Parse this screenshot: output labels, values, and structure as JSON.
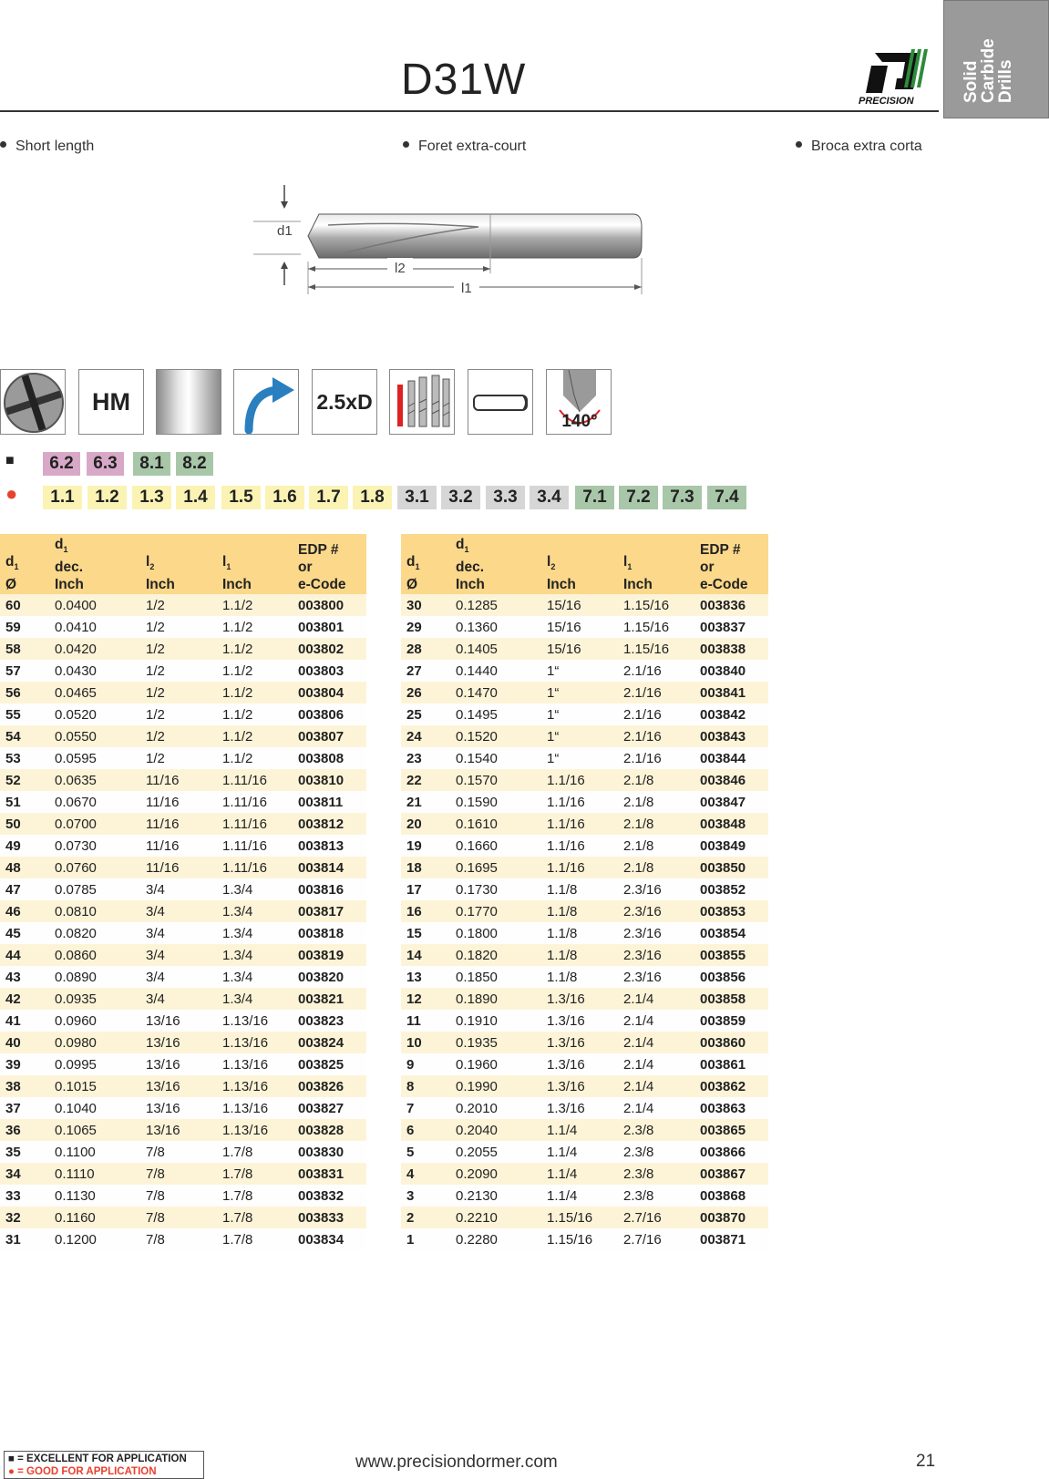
{
  "header": {
    "title": "D31W",
    "logo_text": "PRECISION",
    "side_tab": [
      "Solid",
      "Carbide",
      "Drills"
    ]
  },
  "descriptions": [
    "Short length",
    "Foret extra-court",
    "Broca extra corta"
  ],
  "drawing_labels": {
    "d1": "d1",
    "l2": "l2",
    "l1": "l1"
  },
  "icons": [
    {
      "name": "flute-cross-section-icon"
    },
    {
      "name": "hm-material-icon",
      "label": "HM"
    },
    {
      "name": "bright-finish-icon"
    },
    {
      "name": "right-hand-spiral-icon"
    },
    {
      "name": "depth-ratio-icon",
      "label": "2.5xD"
    },
    {
      "name": "drill-series-icon"
    },
    {
      "name": "cylindrical-shank-icon"
    },
    {
      "name": "point-angle-icon",
      "label": "140°"
    }
  ],
  "applications": {
    "excellent": [
      "6.2",
      "6.3",
      "8.1",
      "8.2"
    ],
    "good": [
      "1.1",
      "1.2",
      "1.3",
      "1.4",
      "1.5",
      "1.6",
      "1.7",
      "1.8",
      "3.1",
      "3.2",
      "3.3",
      "3.4",
      "7.1",
      "7.2",
      "7.3",
      "7.4"
    ]
  },
  "colors": {
    "pink": "#d8a9c6",
    "green": "#a8c7a8",
    "yellow": "#fbf3b4",
    "grey": "#d6d6d6",
    "header": "#fbd88a",
    "stripe": "#fdf4d8"
  },
  "table_headers": {
    "d1": "d",
    "d1_sub": "1",
    "d1_sym": "Ø",
    "dec": "dec.",
    "dec_sub": "1",
    "dec_unit": "Inch",
    "l2": "l",
    "l2_sub": "2",
    "l2_unit": "Inch",
    "l1": "l",
    "l1_sub": "1",
    "l1_unit": "Inch",
    "edp1": "EDP #",
    "edp2": "or",
    "edp3": "e-Code"
  },
  "table_left": [
    [
      "60",
      "0.0400",
      "1/2",
      "1.1/2",
      "003800"
    ],
    [
      "59",
      "0.0410",
      "1/2",
      "1.1/2",
      "003801"
    ],
    [
      "58",
      "0.0420",
      "1/2",
      "1.1/2",
      "003802"
    ],
    [
      "57",
      "0.0430",
      "1/2",
      "1.1/2",
      "003803"
    ],
    [
      "56",
      "0.0465",
      "1/2",
      "1.1/2",
      "003804"
    ],
    [
      "55",
      "0.0520",
      "1/2",
      "1.1/2",
      "003806"
    ],
    [
      "54",
      "0.0550",
      "1/2",
      "1.1/2",
      "003807"
    ],
    [
      "53",
      "0.0595",
      "1/2",
      "1.1/2",
      "003808"
    ],
    [
      "52",
      "0.0635",
      "11/16",
      "1.11/16",
      "003810"
    ],
    [
      "51",
      "0.0670",
      "11/16",
      "1.11/16",
      "003811"
    ],
    [
      "50",
      "0.0700",
      "11/16",
      "1.11/16",
      "003812"
    ],
    [
      "49",
      "0.0730",
      "11/16",
      "1.11/16",
      "003813"
    ],
    [
      "48",
      "0.0760",
      "11/16",
      "1.11/16",
      "003814"
    ],
    [
      "47",
      "0.0785",
      "3/4",
      "1.3/4",
      "003816"
    ],
    [
      "46",
      "0.0810",
      "3/4",
      "1.3/4",
      "003817"
    ],
    [
      "45",
      "0.0820",
      "3/4",
      "1.3/4",
      "003818"
    ],
    [
      "44",
      "0.0860",
      "3/4",
      "1.3/4",
      "003819"
    ],
    [
      "43",
      "0.0890",
      "3/4",
      "1.3/4",
      "003820"
    ],
    [
      "42",
      "0.0935",
      "3/4",
      "1.3/4",
      "003821"
    ],
    [
      "41",
      "0.0960",
      "13/16",
      "1.13/16",
      "003823"
    ],
    [
      "40",
      "0.0980",
      "13/16",
      "1.13/16",
      "003824"
    ],
    [
      "39",
      "0.0995",
      "13/16",
      "1.13/16",
      "003825"
    ],
    [
      "38",
      "0.1015",
      "13/16",
      "1.13/16",
      "003826"
    ],
    [
      "37",
      "0.1040",
      "13/16",
      "1.13/16",
      "003827"
    ],
    [
      "36",
      "0.1065",
      "13/16",
      "1.13/16",
      "003828"
    ],
    [
      "35",
      "0.1100",
      "7/8",
      "1.7/8",
      "003830"
    ],
    [
      "34",
      "0.1110",
      "7/8",
      "1.7/8",
      "003831"
    ],
    [
      "33",
      "0.1130",
      "7/8",
      "1.7/8",
      "003832"
    ],
    [
      "32",
      "0.1160",
      "7/8",
      "1.7/8",
      "003833"
    ],
    [
      "31",
      "0.1200",
      "7/8",
      "1.7/8",
      "003834"
    ]
  ],
  "table_right": [
    [
      "30",
      "0.1285",
      "15/16",
      "1.15/16",
      "003836"
    ],
    [
      "29",
      "0.1360",
      "15/16",
      "1.15/16",
      "003837"
    ],
    [
      "28",
      "0.1405",
      "15/16",
      "1.15/16",
      "003838"
    ],
    [
      "27",
      "0.1440",
      "1“",
      "2.1/16",
      "003840"
    ],
    [
      "26",
      "0.1470",
      "1“",
      "2.1/16",
      "003841"
    ],
    [
      "25",
      "0.1495",
      "1“",
      "2.1/16",
      "003842"
    ],
    [
      "24",
      "0.1520",
      "1“",
      "2.1/16",
      "003843"
    ],
    [
      "23",
      "0.1540",
      "1“",
      "2.1/16",
      "003844"
    ],
    [
      "22",
      "0.1570",
      "1.1/16",
      "2.1/8",
      "003846"
    ],
    [
      "21",
      "0.1590",
      "1.1/16",
      "2.1/8",
      "003847"
    ],
    [
      "20",
      "0.1610",
      "1.1/16",
      "2.1/8",
      "003848"
    ],
    [
      "19",
      "0.1660",
      "1.1/16",
      "2.1/8",
      "003849"
    ],
    [
      "18",
      "0.1695",
      "1.1/16",
      "2.1/8",
      "003850"
    ],
    [
      "17",
      "0.1730",
      "1.1/8",
      "2.3/16",
      "003852"
    ],
    [
      "16",
      "0.1770",
      "1.1/8",
      "2.3/16",
      "003853"
    ],
    [
      "15",
      "0.1800",
      "1.1/8",
      "2.3/16",
      "003854"
    ],
    [
      "14",
      "0.1820",
      "1.1/8",
      "2.3/16",
      "003855"
    ],
    [
      "13",
      "0.1850",
      "1.1/8",
      "2.3/16",
      "003856"
    ],
    [
      "12",
      "0.1890",
      "1.3/16",
      "2.1/4",
      "003858"
    ],
    [
      "11",
      "0.1910",
      "1.3/16",
      "2.1/4",
      "003859"
    ],
    [
      "10",
      "0.1935",
      "1.3/16",
      "2.1/4",
      "003860"
    ],
    [
      "9",
      "0.1960",
      "1.3/16",
      "2.1/4",
      "003861"
    ],
    [
      "8",
      "0.1990",
      "1.3/16",
      "2.1/4",
      "003862"
    ],
    [
      "7",
      "0.2010",
      "1.3/16",
      "2.1/4",
      "003863"
    ],
    [
      "6",
      "0.2040",
      "1.1/4",
      "2.3/8",
      "003865"
    ],
    [
      "5",
      "0.2055",
      "1.1/4",
      "2.3/8",
      "003866"
    ],
    [
      "4",
      "0.2090",
      "1.1/4",
      "2.3/8",
      "003867"
    ],
    [
      "3",
      "0.2130",
      "1.1/4",
      "2.3/8",
      "003868"
    ],
    [
      "2",
      "0.2210",
      "1.15/16",
      "2.7/16",
      "003870"
    ],
    [
      "1",
      "0.2280",
      "1.15/16",
      "2.7/16",
      "003871"
    ]
  ],
  "footer": {
    "legend_excellent": "■ = EXCELLENT FOR APPLICATION",
    "legend_good": "● = GOOD FOR APPLICATION",
    "url": "www.precisiondormer.com",
    "page": "21"
  }
}
